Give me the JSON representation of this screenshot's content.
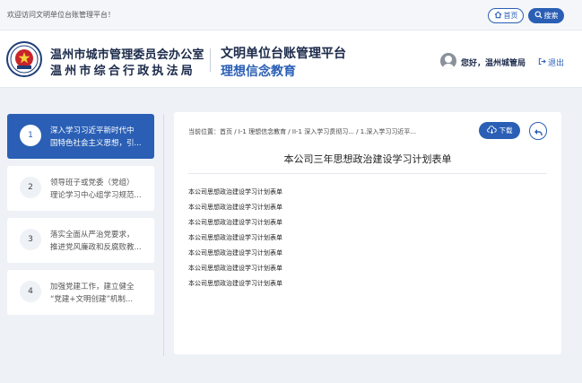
{
  "topbar": {
    "welcome": "欢迎访问文明单位台账管理平台！",
    "home_label": "首页",
    "search_label": "搜索"
  },
  "header": {
    "org_line1": "温州市城市管理委员会办公室",
    "org_line2": "温州市综合行政执法局",
    "platform_name": "文明单位台账管理平台",
    "section_name": "理想信念教育",
    "greeting": "您好，温州城管局",
    "logout_label": "退出"
  },
  "sidebar": {
    "items": [
      {
        "num": "1",
        "line1": "深入学习习近平新时代中",
        "line2": "国特色社会主义思想，引..."
      },
      {
        "num": "2",
        "line1": "领导班子或党委（党组）",
        "line2": "理论学习中心组学习规范..."
      },
      {
        "num": "3",
        "line1": "落实全面从严治党要求，",
        "line2": "推进党风廉政和反腐败教..."
      },
      {
        "num": "4",
        "line1": "加强党建工作，建立健全",
        "line2": "“党建+文明创建”机制..."
      }
    ]
  },
  "main": {
    "breadcrumb": "当前位置：首页 / I-1 理想信念教育 / II-1 深入学习贯彻习... / 1.深入学习习近平...",
    "download_label": "下载",
    "doc_title": "本公司三年思想政治建设学习计划表单",
    "documents": [
      "本公司思想政治建设学习计划表单",
      "本公司思想政治建设学习计划表单",
      "本公司思想政治建设学习计划表单",
      "本公司思想政治建设学习计划表单",
      "本公司思想政治建设学习计划表单",
      "本公司思想政治建设学习计划表单",
      "本公司思想政治建设学习计划表单"
    ]
  },
  "colors": {
    "accent": "#2a5fb5",
    "background": "#eef2f7",
    "title_dark": "#1b2a4a"
  },
  "icons": [
    "home-icon",
    "search-icon",
    "user-avatar-icon",
    "logout-icon",
    "cloud-download-icon",
    "back-arrow-icon"
  ]
}
